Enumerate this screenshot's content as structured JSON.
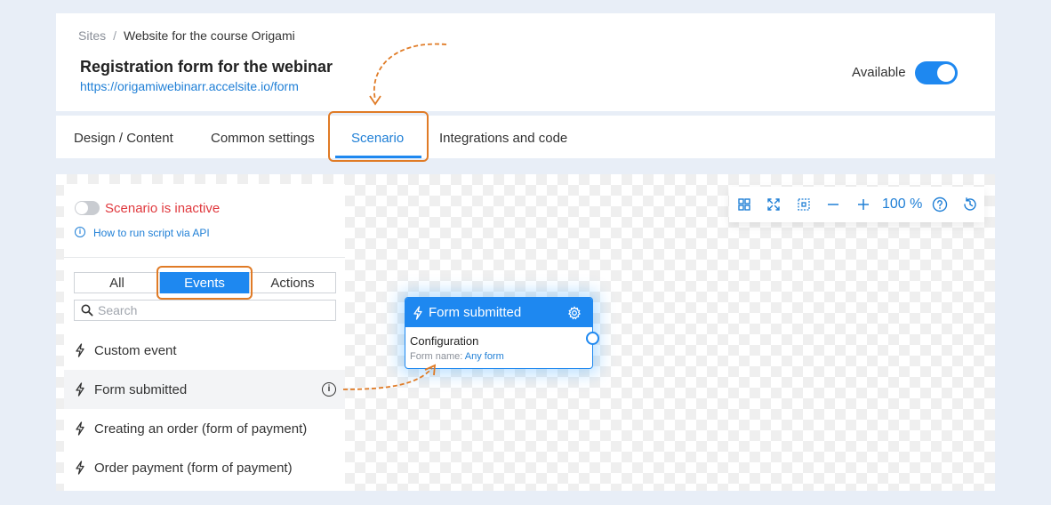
{
  "breadcrumb": {
    "root": "Sites",
    "separator": "/",
    "current": "Website for the course Origami"
  },
  "page": {
    "title": "Registration form for the webinar",
    "url": "https://origamiwebinarr.accelsite.io/form"
  },
  "availability": {
    "label": "Available",
    "enabled": true
  },
  "tabs": [
    {
      "label": "Design / Content"
    },
    {
      "label": "Common settings"
    },
    {
      "label": "Scenario",
      "active": true
    },
    {
      "label": "Integrations and code"
    }
  ],
  "scenario": {
    "status": "Scenario is inactive",
    "api_link": "How to run script via API"
  },
  "filters": [
    {
      "label": "All"
    },
    {
      "label": "Events",
      "active": true
    },
    {
      "label": "Actions"
    }
  ],
  "search": {
    "placeholder": "Search",
    "value": ""
  },
  "events": [
    {
      "label": "Custom event"
    },
    {
      "label": "Form submitted"
    },
    {
      "label": "Creating an order (form of payment)"
    },
    {
      "label": "Order payment (form of payment)"
    }
  ],
  "toolbar": {
    "zoom": "100 %"
  },
  "node": {
    "title": "Form submitted",
    "section": "Configuration",
    "form_label": "Form name:",
    "form_value": "Any form"
  },
  "colors": {
    "accent": "#1e88f0",
    "highlight": "#e07b26",
    "error": "#e0393e"
  }
}
